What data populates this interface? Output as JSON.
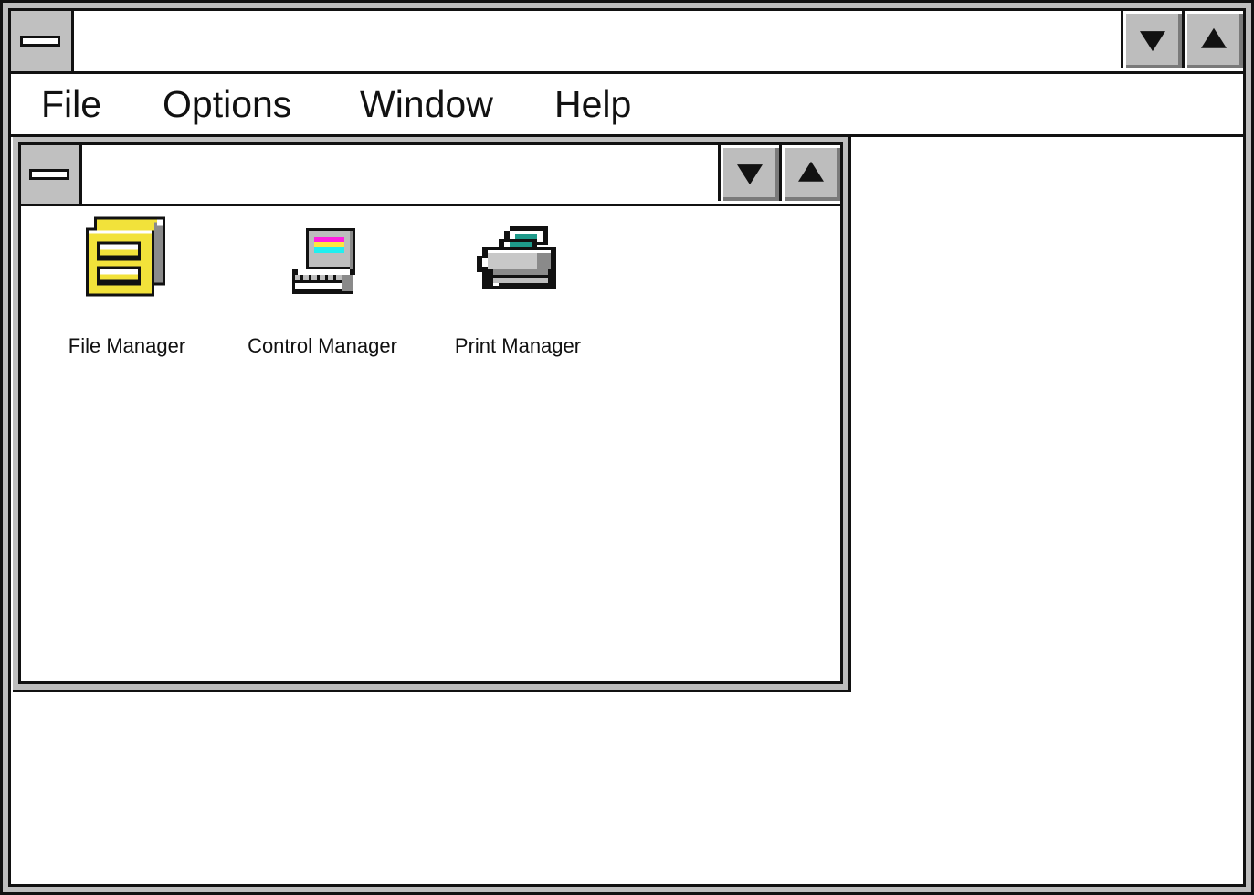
{
  "main_window": {
    "title": "",
    "menu": [
      {
        "label": "File"
      },
      {
        "label": "Options"
      },
      {
        "label": "Window"
      },
      {
        "label": "Help"
      }
    ],
    "controls": {
      "minimize": "minimize",
      "maximize": "maximize"
    }
  },
  "child_window": {
    "title": "",
    "icons": [
      {
        "label": "File Manager",
        "icon": "file-cabinet-icon"
      },
      {
        "label": "Control Manager",
        "icon": "computer-icon"
      },
      {
        "label": "Print Manager",
        "icon": "printer-icon"
      }
    ]
  },
  "colors": {
    "frame": "#bdbdbd",
    "border": "#111111",
    "cabinet_yellow": "#f2e23a",
    "screen_magenta": "#ff1ee0",
    "screen_yellow": "#ffe640",
    "screen_cyan": "#20f0f0",
    "paper_teal": "#1e9a8a"
  }
}
